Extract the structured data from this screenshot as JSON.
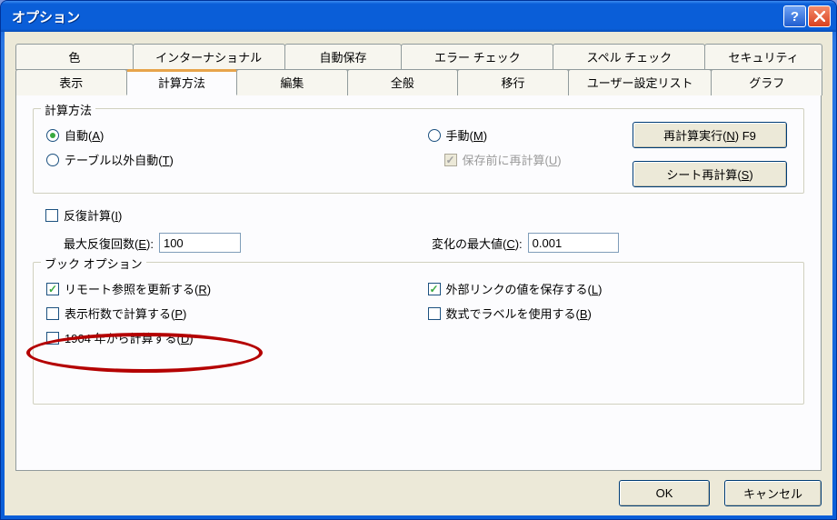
{
  "window_title": "オプション",
  "tabs_row1": [
    "色",
    "インターナショナル",
    "自動保存",
    "エラー チェック",
    "スペル チェック",
    "セキュリティ"
  ],
  "tabs_row2": [
    "表示",
    "計算方法",
    "編集",
    "全般",
    "移行",
    "ユーザー設定リスト",
    "グラフ"
  ],
  "active_tab": "計算方法",
  "calc_method": {
    "title": "計算方法",
    "auto": "自動(A)",
    "auto_except_tables": "テーブル以外自動(T)",
    "manual": "手動(M)",
    "recalc_before_save": "保存前に再計算(U)",
    "btn_recalc_now": "再計算実行(N) F9",
    "btn_recalc_sheet": "シート再計算(S)"
  },
  "iteration": {
    "enable": "反復計算(I)",
    "max_iter_label": "最大反復回数(E):",
    "max_iter_value": "100",
    "max_change_label": "変化の最大値(C):",
    "max_change_value": "0.001"
  },
  "workbook": {
    "title": "ブック オプション",
    "remote_ref": "リモート参照を更新する(R)",
    "precision_as_displayed": "表示桁数で計算する(P)",
    "date_1904": "1904 年から計算する(D)",
    "save_ext_links": "外部リンクの値を保存する(L)",
    "labels_in_formulas": "数式でラベルを使用する(B)"
  },
  "buttons": {
    "ok": "OK",
    "cancel": "キャンセル"
  }
}
